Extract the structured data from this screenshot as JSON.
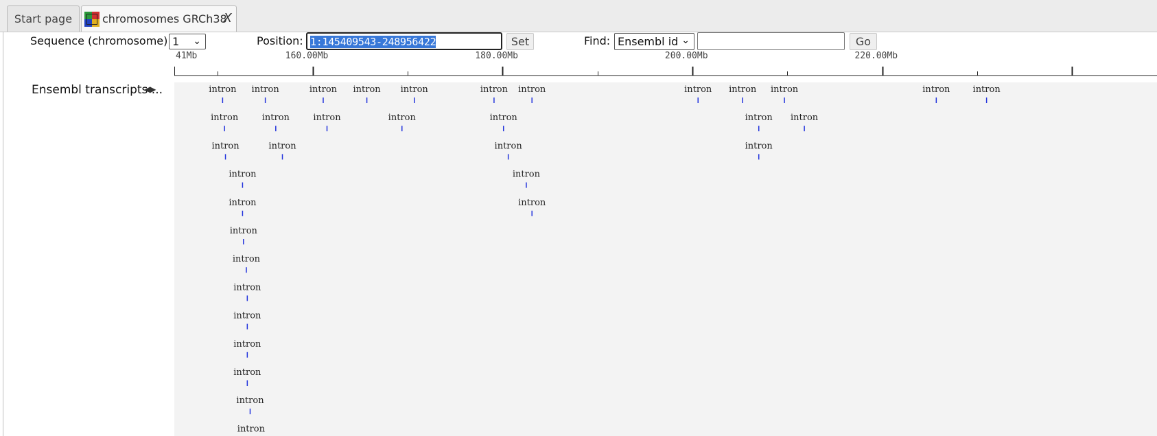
{
  "tabs": {
    "start": "Start page",
    "active": "chromosomes GRCh38",
    "close": "X"
  },
  "toolbar": {
    "sequence_label": "Sequence (chromosome):",
    "chromosome_value": "1",
    "position_label": "Position:",
    "position_value": "1:145409543-248956422",
    "set_label": "Set",
    "find_label": "Find:",
    "find_type": "Ensembl id",
    "find_value": "",
    "go_label": "Go"
  },
  "ruler": {
    "ticks": [
      "41Mb",
      "160.00Mb",
      "180.00Mb",
      "200.00Mb",
      "220.00Mb"
    ]
  },
  "track": {
    "name": "Ensembl transcripts ...",
    "feature_label": "intron"
  },
  "colors": {
    "marker": "#2233dd",
    "track_bg": "#f3f3f3",
    "selection": "#3878d8"
  },
  "chart_data": {
    "type": "genome-track",
    "axis_unit": "Mb",
    "xlim": [
      145.41,
      248.96
    ],
    "features": [
      {
        "pos": 150.5,
        "row": 0
      },
      {
        "pos": 155.0,
        "row": 0
      },
      {
        "pos": 161.1,
        "row": 0
      },
      {
        "pos": 165.7,
        "row": 0
      },
      {
        "pos": 170.7,
        "row": 0
      },
      {
        "pos": 179.1,
        "row": 0
      },
      {
        "pos": 183.1,
        "row": 0
      },
      {
        "pos": 200.6,
        "row": 0
      },
      {
        "pos": 205.3,
        "row": 0
      },
      {
        "pos": 209.7,
        "row": 0
      },
      {
        "pos": 225.7,
        "row": 0
      },
      {
        "pos": 231.0,
        "row": 0
      },
      {
        "pos": 150.7,
        "row": 1
      },
      {
        "pos": 156.1,
        "row": 1
      },
      {
        "pos": 161.5,
        "row": 1
      },
      {
        "pos": 169.4,
        "row": 1
      },
      {
        "pos": 180.1,
        "row": 1
      },
      {
        "pos": 207.0,
        "row": 1
      },
      {
        "pos": 211.8,
        "row": 1
      },
      {
        "pos": 150.8,
        "row": 2
      },
      {
        "pos": 156.8,
        "row": 2
      },
      {
        "pos": 180.6,
        "row": 2
      },
      {
        "pos": 207.0,
        "row": 2
      },
      {
        "pos": 152.6,
        "row": 3
      },
      {
        "pos": 182.5,
        "row": 3
      },
      {
        "pos": 152.6,
        "row": 4
      },
      {
        "pos": 183.1,
        "row": 4
      },
      {
        "pos": 152.7,
        "row": 5
      },
      {
        "pos": 153.0,
        "row": 6
      },
      {
        "pos": 153.1,
        "row": 7
      },
      {
        "pos": 153.1,
        "row": 8
      },
      {
        "pos": 153.1,
        "row": 9
      },
      {
        "pos": 153.1,
        "row": 10
      },
      {
        "pos": 153.4,
        "row": 11
      },
      {
        "pos": 153.5,
        "row": 12
      }
    ]
  }
}
